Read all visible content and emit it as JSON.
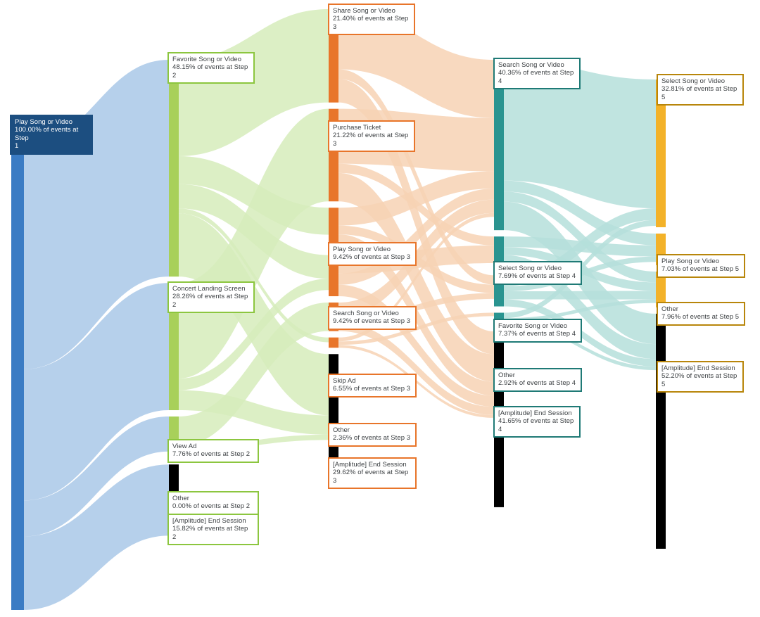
{
  "chart_data": {
    "type": "sankey",
    "title": "",
    "xlabel": "",
    "ylabel": "",
    "units": "percent of events",
    "colors": {
      "step1_node": "#3b7cc4",
      "step1_flow": "#a9c8e8",
      "step2_node": "#a8d05a",
      "step2_flow": "#d6ecbb",
      "step3_node": "#e8752a",
      "step3_flow": "#f7d2b4",
      "step4_node": "#2a9490",
      "step4_flow": "#b5dfdb",
      "step5_node": "#f3b229",
      "step5_flow": "#f8dda0",
      "end_session_node": "#000000",
      "step1_label_bg": "#1c4e80",
      "step1_label_text": "#ffffff",
      "label_bg": "#ffffff",
      "label_text": "#3c4043",
      "step2_label_border": "#8cc63f",
      "step3_label_border": "#e8752a",
      "step4_label_border": "#1f7a76",
      "step5_label_border": "#b8860b",
      "step1_label_border": "#1c4e80"
    },
    "steps": [
      {
        "step": 1,
        "nodes": [
          {
            "id": "s1-play",
            "name": "Play Song or Video",
            "value": 100.0,
            "label_line1": "Play Song or Video",
            "label_line2": "100.00% of events at Step",
            "label_line3": "1"
          }
        ]
      },
      {
        "step": 2,
        "nodes": [
          {
            "id": "s2-favorite",
            "name": "Favorite Song or Video",
            "value": 48.15,
            "label_line1": "Favorite Song or Video",
            "label_line2": "48.15% of events at Step",
            "label_line3": "2"
          },
          {
            "id": "s2-concert",
            "name": "Concert Landing Screen",
            "value": 28.26,
            "label_line1": "Concert Landing Screen",
            "label_line2": "28.26% of events at Step",
            "label_line3": "2"
          },
          {
            "id": "s2-viewad",
            "name": "View Ad",
            "value": 7.76,
            "label_line1": "View Ad",
            "label_line2": "7.76% of events at Step 2",
            "label_line3": ""
          },
          {
            "id": "s2-other",
            "name": "Other",
            "value": 0.0,
            "label_line1": "Other",
            "label_line2": "0.00% of events at Step 2",
            "label_line3": ""
          },
          {
            "id": "s2-end",
            "name": "[Amplitude] End Session",
            "value": 15.82,
            "label_line1": "[Amplitude] End Session",
            "label_line2": "15.82% of events at Step",
            "label_line3": "2"
          }
        ]
      },
      {
        "step": 3,
        "nodes": [
          {
            "id": "s3-share",
            "name": "Share Song or Video",
            "value": 21.4,
            "label_line1": "Share Song or Video",
            "label_line2": "21.40% of events at Step",
            "label_line3": "3"
          },
          {
            "id": "s3-purchase",
            "name": "Purchase Ticket",
            "value": 21.22,
            "label_line1": "Purchase Ticket",
            "label_line2": "21.22% of events at Step",
            "label_line3": "3"
          },
          {
            "id": "s3-play",
            "name": "Play Song or Video",
            "value": 9.42,
            "label_line1": "Play Song or Video",
            "label_line2": "9.42% of events at Step 3",
            "label_line3": ""
          },
          {
            "id": "s3-search",
            "name": "Search Song or Video",
            "value": 9.42,
            "label_line1": "Search Song or Video",
            "label_line2": "9.42% of events at Step 3",
            "label_line3": ""
          },
          {
            "id": "s3-skipad",
            "name": "Skip Ad",
            "value": 6.55,
            "label_line1": "Skip Ad",
            "label_line2": "6.55% of events at Step 3",
            "label_line3": ""
          },
          {
            "id": "s3-other",
            "name": "Other",
            "value": 2.36,
            "label_line1": "Other",
            "label_line2": "2.36% of events at Step 3",
            "label_line3": ""
          },
          {
            "id": "s3-end",
            "name": "[Amplitude] End Session",
            "value": 29.62,
            "label_line1": "[Amplitude] End Session",
            "label_line2": "29.62% of events at Step",
            "label_line3": "3"
          }
        ]
      },
      {
        "step": 4,
        "nodes": [
          {
            "id": "s4-search",
            "name": "Search Song or Video",
            "value": 40.36,
            "label_line1": "Search Song or Video",
            "label_line2": "40.36% of events at Step",
            "label_line3": "4"
          },
          {
            "id": "s4-select",
            "name": "Select Song or Video",
            "value": 7.69,
            "label_line1": "Select Song or Video",
            "label_line2": "7.69% of events at Step 4",
            "label_line3": ""
          },
          {
            "id": "s4-favorite",
            "name": "Favorite Song or Video",
            "value": 7.37,
            "label_line1": "Favorite Song or Video",
            "label_line2": "7.37% of events at Step 4",
            "label_line3": ""
          },
          {
            "id": "s4-other",
            "name": "Other",
            "value": 2.92,
            "label_line1": "Other",
            "label_line2": "2.92% of events at Step 4",
            "label_line3": ""
          },
          {
            "id": "s4-end",
            "name": "[Amplitude] End Session",
            "value": 41.65,
            "label_line1": "[Amplitude] End Session",
            "label_line2": "41.65% of events at Step",
            "label_line3": "4"
          }
        ]
      },
      {
        "step": 5,
        "nodes": [
          {
            "id": "s5-select",
            "name": "Select Song or Video",
            "value": 32.81,
            "label_line1": "Select Song or Video",
            "label_line2": "32.81% of events at Step",
            "label_line3": "5"
          },
          {
            "id": "s5-play",
            "name": "Play Song or Video",
            "value": 7.03,
            "label_line1": "Play Song or Video",
            "label_line2": "7.03% of events at Step 5",
            "label_line3": ""
          },
          {
            "id": "s5-other",
            "name": "Other",
            "value": 7.96,
            "label_line1": "Other",
            "label_line2": "7.96% of events at Step 5",
            "label_line3": ""
          },
          {
            "id": "s5-end",
            "name": "[Amplitude] End Session",
            "value": 52.2,
            "label_line1": "[Amplitude] End Session",
            "label_line2": "52.20% of events at Step",
            "label_line3": "5"
          }
        ]
      }
    ],
    "links": [
      {
        "source": "s1-play",
        "target": "s2-favorite",
        "value": 48.15
      },
      {
        "source": "s1-play",
        "target": "s2-concert",
        "value": 28.26
      },
      {
        "source": "s1-play",
        "target": "s2-viewad",
        "value": 7.76
      },
      {
        "source": "s1-play",
        "target": "s2-other",
        "value": 0.0
      },
      {
        "source": "s1-play",
        "target": "s2-end",
        "value": 15.82
      },
      {
        "source": "s2-favorite",
        "target": "s3-share",
        "value": 21.4
      },
      {
        "source": "s2-favorite",
        "target": "s3-play",
        "value": 6.2
      },
      {
        "source": "s2-favorite",
        "target": "s3-search",
        "value": 5.4
      },
      {
        "source": "s2-favorite",
        "target": "s3-other",
        "value": 1.1
      },
      {
        "source": "s2-favorite",
        "target": "s3-end",
        "value": 14.05
      },
      {
        "source": "s2-concert",
        "target": "s3-purchase",
        "value": 21.22
      },
      {
        "source": "s2-concert",
        "target": "s3-search",
        "value": 2.6
      },
      {
        "source": "s2-concert",
        "target": "s3-end",
        "value": 4.44
      },
      {
        "source": "s2-viewad",
        "target": "s3-skipad",
        "value": 6.55
      },
      {
        "source": "s2-viewad",
        "target": "s3-end",
        "value": 1.21
      },
      {
        "source": "s2-other",
        "target": "s3-other",
        "value": 0.0
      },
      {
        "source": "s3-share",
        "target": "s4-search",
        "value": 13.8
      },
      {
        "source": "s3-share",
        "target": "s4-favorite",
        "value": 2.2
      },
      {
        "source": "s3-share",
        "target": "s4-end",
        "value": 5.4
      },
      {
        "source": "s3-purchase",
        "target": "s4-search",
        "value": 12.6
      },
      {
        "source": "s3-purchase",
        "target": "s4-select",
        "value": 2.1
      },
      {
        "source": "s3-purchase",
        "target": "s4-end",
        "value": 6.52
      },
      {
        "source": "s3-play",
        "target": "s4-search",
        "value": 4.1
      },
      {
        "source": "s3-play",
        "target": "s4-favorite",
        "value": 2.0
      },
      {
        "source": "s3-play",
        "target": "s4-end",
        "value": 3.32
      },
      {
        "source": "s3-search",
        "target": "s4-select",
        "value": 4.2
      },
      {
        "source": "s3-search",
        "target": "s4-search",
        "value": 2.6
      },
      {
        "source": "s3-search",
        "target": "s4-end",
        "value": 2.62
      },
      {
        "source": "s3-skipad",
        "target": "s4-search",
        "value": 3.2
      },
      {
        "source": "s3-skipad",
        "target": "s4-favorite",
        "value": 1.4
      },
      {
        "source": "s3-skipad",
        "target": "s4-end",
        "value": 1.95
      },
      {
        "source": "s3-other",
        "target": "s4-search",
        "value": 0.9
      },
      {
        "source": "s3-other",
        "target": "s4-other",
        "value": 0.8
      },
      {
        "source": "s3-other",
        "target": "s4-end",
        "value": 0.66
      },
      {
        "source": "s4-search",
        "target": "s5-select",
        "value": 28.6
      },
      {
        "source": "s4-search",
        "target": "s5-play",
        "value": 2.6
      },
      {
        "source": "s4-search",
        "target": "s5-other",
        "value": 2.4
      },
      {
        "source": "s4-search",
        "target": "s5-end",
        "value": 6.76
      },
      {
        "source": "s4-select",
        "target": "s5-play",
        "value": 2.5
      },
      {
        "source": "s4-select",
        "target": "s5-other",
        "value": 1.9
      },
      {
        "source": "s4-select",
        "target": "s5-end",
        "value": 3.29
      },
      {
        "source": "s4-favorite",
        "target": "s5-select",
        "value": 2.6
      },
      {
        "source": "s4-favorite",
        "target": "s5-play",
        "value": 1.2
      },
      {
        "source": "s4-favorite",
        "target": "s5-other",
        "value": 1.9
      },
      {
        "source": "s4-favorite",
        "target": "s5-end",
        "value": 1.67
      },
      {
        "source": "s4-other",
        "target": "s5-select",
        "value": 1.3
      },
      {
        "source": "s4-other",
        "target": "s5-other",
        "value": 0.8
      },
      {
        "source": "s4-other",
        "target": "s5-end",
        "value": 0.82
      }
    ]
  }
}
